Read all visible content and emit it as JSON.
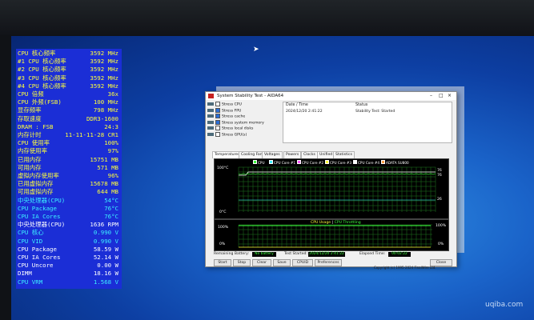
{
  "osd": {
    "rows": [
      {
        "label": "CPU 核心频率",
        "value": "3592 MHz",
        "color": "#ffff3a"
      },
      {
        "label": "#1 CPU 核心频率",
        "value": "3592 MHz",
        "color": "#ffff3a"
      },
      {
        "label": "#2 CPU 核心频率",
        "value": "3592 MHz",
        "color": "#ffff3a"
      },
      {
        "label": "#3 CPU 核心频率",
        "value": "3592 MHz",
        "color": "#ffff3a"
      },
      {
        "label": "#4 CPU 核心频率",
        "value": "3592 MHz",
        "color": "#ffff3a"
      },
      {
        "label": "CPU 倍频",
        "value": "36x",
        "color": "#ffff3a"
      },
      {
        "label": "CPU 外频(FSB)",
        "value": "100 MHz",
        "color": "#ffff3a"
      },
      {
        "label": "显存频率",
        "value": "798 MHz",
        "color": "#ffff3a"
      },
      {
        "label": "存取速度",
        "value": "DDR3-1600",
        "color": "#ffff3a"
      },
      {
        "label": "DRAM : FSB",
        "value": "24:3",
        "color": "#ffff3a"
      },
      {
        "label": "内存计时",
        "value": "11-11-11-28 CR1",
        "color": "#ffff3a"
      },
      {
        "label": "CPU 使用率",
        "value": "100%",
        "color": "#ffff3a"
      },
      {
        "label": "内存使用率",
        "value": "97%",
        "color": "#ffff3a"
      },
      {
        "label": "已用内存",
        "value": "15751 MB",
        "color": "#ffff3a"
      },
      {
        "label": "可用内存",
        "value": "571 MB",
        "color": "#ffff3a"
      },
      {
        "label": "虚拟内存使用率",
        "value": "96%",
        "color": "#ffff3a"
      },
      {
        "label": "已用虚拟内存",
        "value": "15678 MB",
        "color": "#ffff3a"
      },
      {
        "label": "可用虚拟内存",
        "value": "644 MB",
        "color": "#ffff3a"
      },
      {
        "label": "中央处理器(CPU)",
        "value": "54°C",
        "color": "#3cf0ff"
      },
      {
        "label": "CPU Package",
        "value": "76°C",
        "color": "#3cf0ff"
      },
      {
        "label": "CPU IA Cores",
        "value": "76°C",
        "color": "#3cf0ff"
      },
      {
        "label": "中央处理器(CPU)",
        "value": "1636 RPM",
        "color": "#ffffff"
      },
      {
        "label": "CPU 核心",
        "value": "0.990 V",
        "color": "#3cf0ff"
      },
      {
        "label": "CPU VID",
        "value": "0.990 V",
        "color": "#3cf0ff"
      },
      {
        "label": "CPU Package",
        "value": "58.59 W",
        "color": "#ffffff"
      },
      {
        "label": "CPU IA Cores",
        "value": "52.14 W",
        "color": "#ffffff"
      },
      {
        "label": "CPU Uncore",
        "value": "0.00 W",
        "color": "#ffffff"
      },
      {
        "label": "DIMM",
        "value": "18.16 W",
        "color": "#ffffff"
      },
      {
        "label": "CPU VRM",
        "value": "1.568 V",
        "color": "#3cf0ff"
      }
    ]
  },
  "window": {
    "title": "System Stability Test - AIDA64",
    "controls": [
      "–",
      "□",
      "×"
    ],
    "options": [
      {
        "label": "Stress CPU",
        "checked": false
      },
      {
        "label": "Stress FPU",
        "checked": true
      },
      {
        "label": "Stress cache",
        "checked": true
      },
      {
        "label": "Stress system memory",
        "checked": true
      },
      {
        "label": "Stress local disks",
        "checked": false
      },
      {
        "label": "Stress GPU(s)",
        "checked": false
      }
    ],
    "status": {
      "date_header": "Date / Time",
      "status_header": "Status",
      "date_value": "2024/12/20 2:41:22",
      "status_value": "Stability Test: Started"
    },
    "tabs": [
      "Temperatures",
      "Cooling Fans",
      "Voltages",
      "Powers",
      "Clocks",
      "Unified",
      "Statistics"
    ],
    "temp_graph": {
      "legend": [
        "CPU",
        "CPU Core #1",
        "CPU Core #2",
        "CPU Core #3",
        "CPU Core #4",
        "ADATA SU800"
      ],
      "y_top": "100°C",
      "y_bottom": "0°C",
      "right_labels": [
        "76",
        "76",
        "26"
      ]
    },
    "usage_graph": {
      "title_a": "CPU Usage",
      "title_sep": "|",
      "title_b": "CPU Throttling",
      "y_top": "100%",
      "y_bottom": "0%",
      "right_top": "100%",
      "right_bottom": "0%"
    },
    "bottom": {
      "battery_label": "Remaining Battery:",
      "battery_value": "No battery",
      "started_label": "Test Started:",
      "started_value": "2024/12/20 2:41:22",
      "elapsed_label": "Elapsed Time:",
      "elapsed_value": "00:02:22",
      "buttons": [
        "Start",
        "Stop",
        "Clear",
        "Save",
        "CPUID",
        "Preferences",
        "Close"
      ],
      "copyright": "Copyright (c) 1995-2024 FinalWire Ltd."
    }
  },
  "watermark": "uqiba.com",
  "colors": {
    "osd_bg": "#1b2ed6",
    "desktop": "#1a63c9",
    "graph_green": "#2bd62b",
    "graph_white": "#ffffff"
  }
}
